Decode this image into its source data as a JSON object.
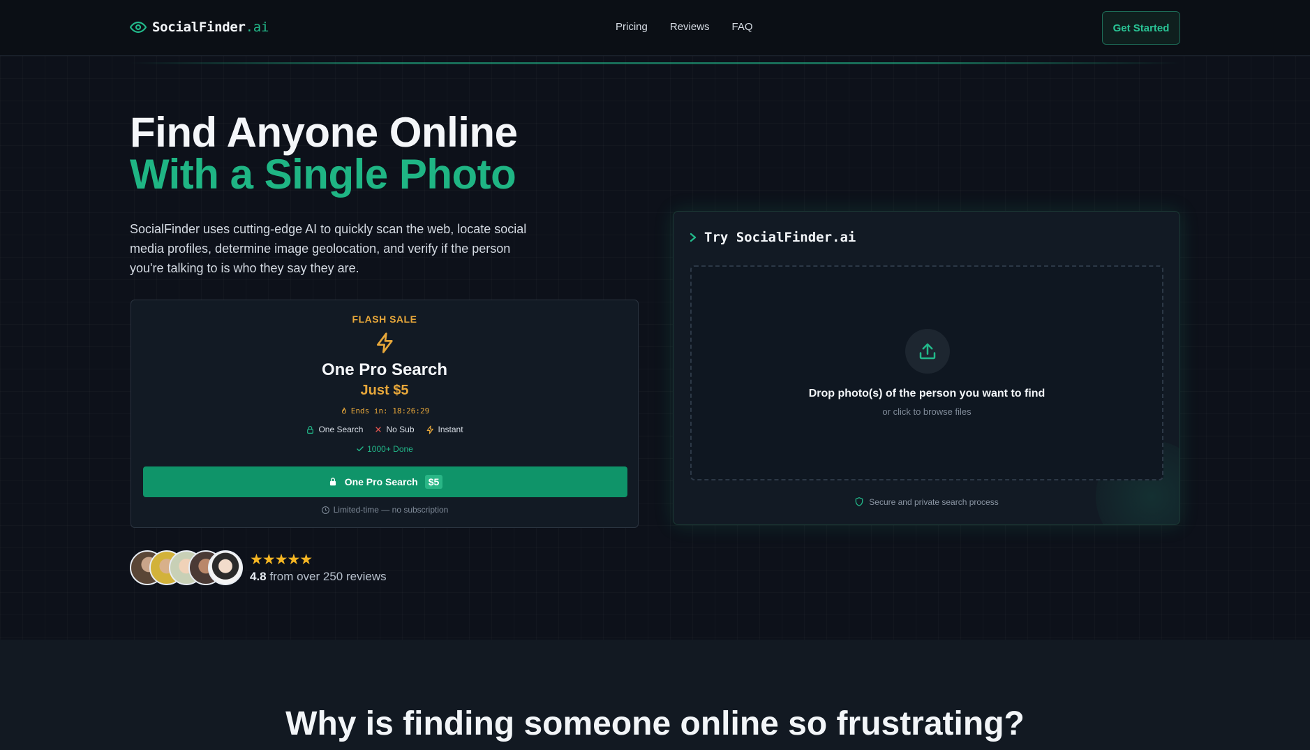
{
  "nav": {
    "logo_main": "SocialFinder",
    "logo_accent": ".ai",
    "links": [
      "Pricing",
      "Reviews",
      "FAQ"
    ],
    "cta": "Get Started"
  },
  "hero": {
    "title_line1": "Find Anyone Online",
    "title_line2": "With a Single Photo",
    "description": "SocialFinder uses cutting-edge AI to quickly scan the web, locate social media profiles, determine image geolocation, and verify if the person you're talking to is who they say they are."
  },
  "flash_sale": {
    "label": "FLASH SALE",
    "title": "One Pro Search",
    "price": "Just $5",
    "timer": "Ends in: 18:26:29",
    "features": [
      "One Search",
      "No Sub",
      "Instant"
    ],
    "done": "1000+ Done",
    "cta_label": "One Pro Search",
    "cta_price": "$5",
    "limited": "Limited-time — no subscription"
  },
  "reviews": {
    "stars": "★★★★★",
    "rating": "4.8",
    "text": "from over 250 reviews"
  },
  "upload": {
    "title": "Try SocialFinder.ai",
    "drop_title": "Drop photo(s) of the person you want to find",
    "drop_sub": "or click to browse files",
    "secure": "Secure and private search process"
  },
  "section2": {
    "title": "Why is finding someone online so frustrating?"
  },
  "colors": {
    "accent": "#1fb584",
    "amber": "#e7a73a",
    "background": "#0c1017",
    "card": "#121a24"
  }
}
